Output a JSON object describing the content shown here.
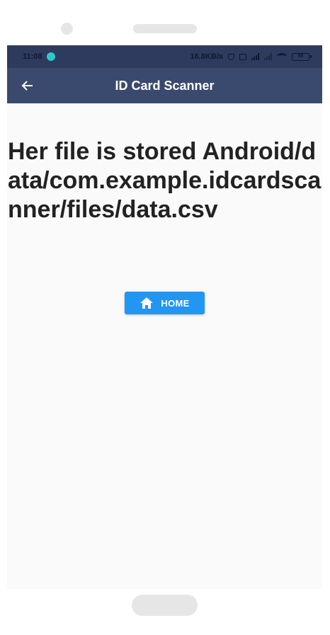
{
  "status_bar": {
    "time": "11:08",
    "net_speed": "16.8KB/s",
    "battery": "85"
  },
  "app_bar": {
    "title": "ID Card Scanner",
    "back_icon": "arrow-left-icon"
  },
  "content": {
    "message": "Her file is stored Android/data/com.example.idcardscanner/files/data.csv",
    "home_button": {
      "label": "HOME",
      "icon": "home-icon"
    }
  },
  "colors": {
    "app_bar": "#3a4a6e",
    "status_bar": "#2e3b5e",
    "button": "#2196f3",
    "background": "#fafafa"
  }
}
